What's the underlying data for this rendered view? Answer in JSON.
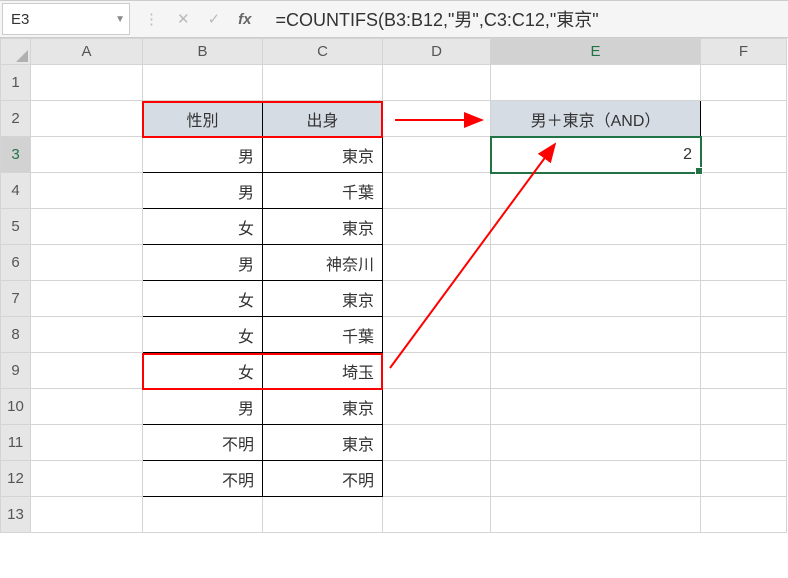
{
  "namebox": {
    "value": "E3"
  },
  "formula": "=COUNTIFS(B3:B12,\"男\",C3:C12,\"東京\"",
  "columns": [
    "A",
    "B",
    "C",
    "D",
    "E",
    "F"
  ],
  "rows": [
    "1",
    "2",
    "3",
    "4",
    "5",
    "6",
    "7",
    "8",
    "9",
    "10",
    "11",
    "12",
    "13"
  ],
  "table": {
    "headers": {
      "b": "性別",
      "c": "出身"
    },
    "data": [
      {
        "b": "男",
        "c": "東京"
      },
      {
        "b": "男",
        "c": "千葉"
      },
      {
        "b": "女",
        "c": "東京"
      },
      {
        "b": "男",
        "c": "神奈川"
      },
      {
        "b": "女",
        "c": "東京"
      },
      {
        "b": "女",
        "c": "千葉"
      },
      {
        "b": "女",
        "c": "埼玉"
      },
      {
        "b": "男",
        "c": "東京"
      },
      {
        "b": "不明",
        "c": "東京"
      },
      {
        "b": "不明",
        "c": "不明"
      }
    ]
  },
  "summary": {
    "header": "男＋東京（AND）",
    "value": "2"
  },
  "active": {
    "col": "E",
    "row": "3"
  },
  "icons": {
    "cancel": "✕",
    "enter": "✓",
    "fx": "fx",
    "dropdown": "▼",
    "divider": "⋮"
  }
}
